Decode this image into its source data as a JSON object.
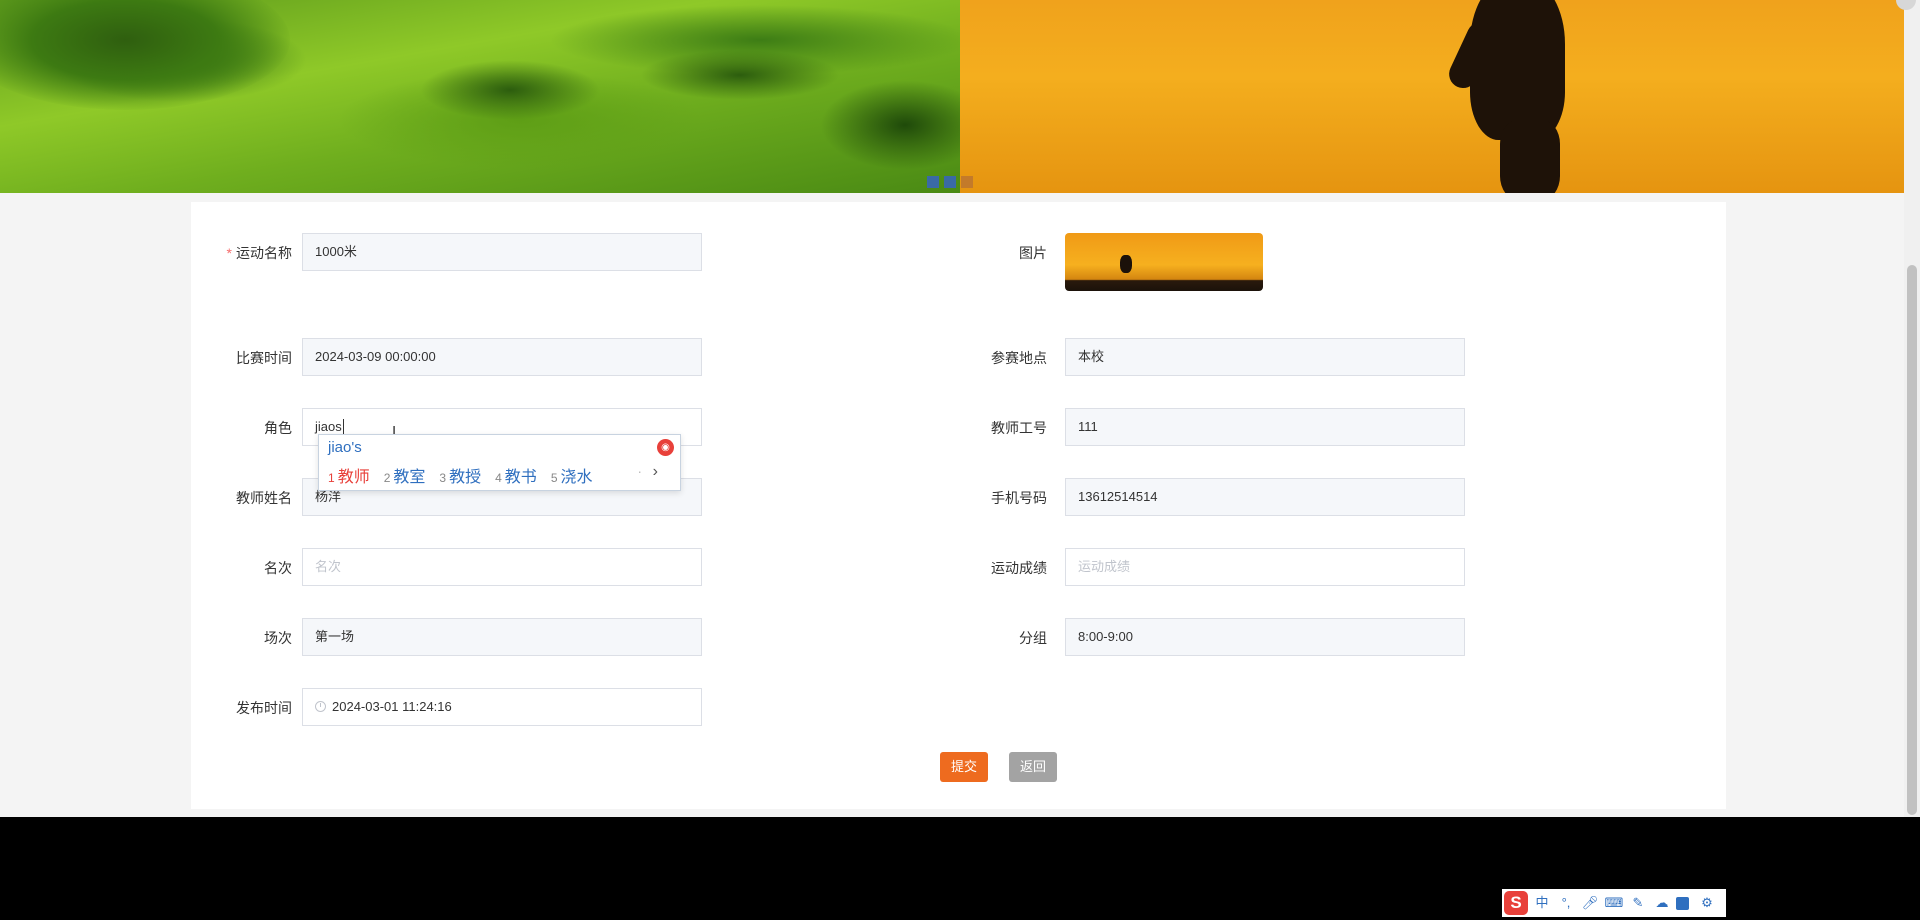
{
  "form": {
    "sport_name": {
      "label": "运动名称",
      "value": "1000米",
      "required_mark": "*"
    },
    "image": {
      "label": "图片"
    },
    "match_time": {
      "label": "比赛时间",
      "value": "2024-03-09 00:00:00"
    },
    "venue": {
      "label": "参赛地点",
      "value": "本校"
    },
    "role": {
      "label": "角色",
      "value": "jiaos"
    },
    "teacher_id": {
      "label": "教师工号",
      "value": "111"
    },
    "teacher_name": {
      "label": "教师姓名",
      "value": "杨洋"
    },
    "phone": {
      "label": "手机号码",
      "value": "13612514514"
    },
    "rank": {
      "label": "名次",
      "placeholder": "名次"
    },
    "score": {
      "label": "运动成绩",
      "placeholder": "运动成绩"
    },
    "session": {
      "label": "场次",
      "value": "第一场"
    },
    "group": {
      "label": "分组",
      "value": "8:00-9:00"
    },
    "publish_time": {
      "label": "发布时间",
      "value": "2024-03-01 11:24:16"
    }
  },
  "actions": {
    "submit": "提交",
    "back": "返回"
  },
  "ime": {
    "pinyin": "jiao's",
    "candidates": [
      {
        "num": "1",
        "text": "教师"
      },
      {
        "num": "2",
        "text": "教室"
      },
      {
        "num": "3",
        "text": "教授"
      },
      {
        "num": "4",
        "text": "教书"
      },
      {
        "num": "5",
        "text": "浇水"
      }
    ],
    "next": "›"
  },
  "tray": {
    "logo": "S",
    "lang": "中",
    "punct": "°,"
  },
  "colors": {
    "submit": "#ee6b1f",
    "back": "#a3a3a3",
    "required": "#f56c6c",
    "ime_accent": "#2f6fbf"
  }
}
